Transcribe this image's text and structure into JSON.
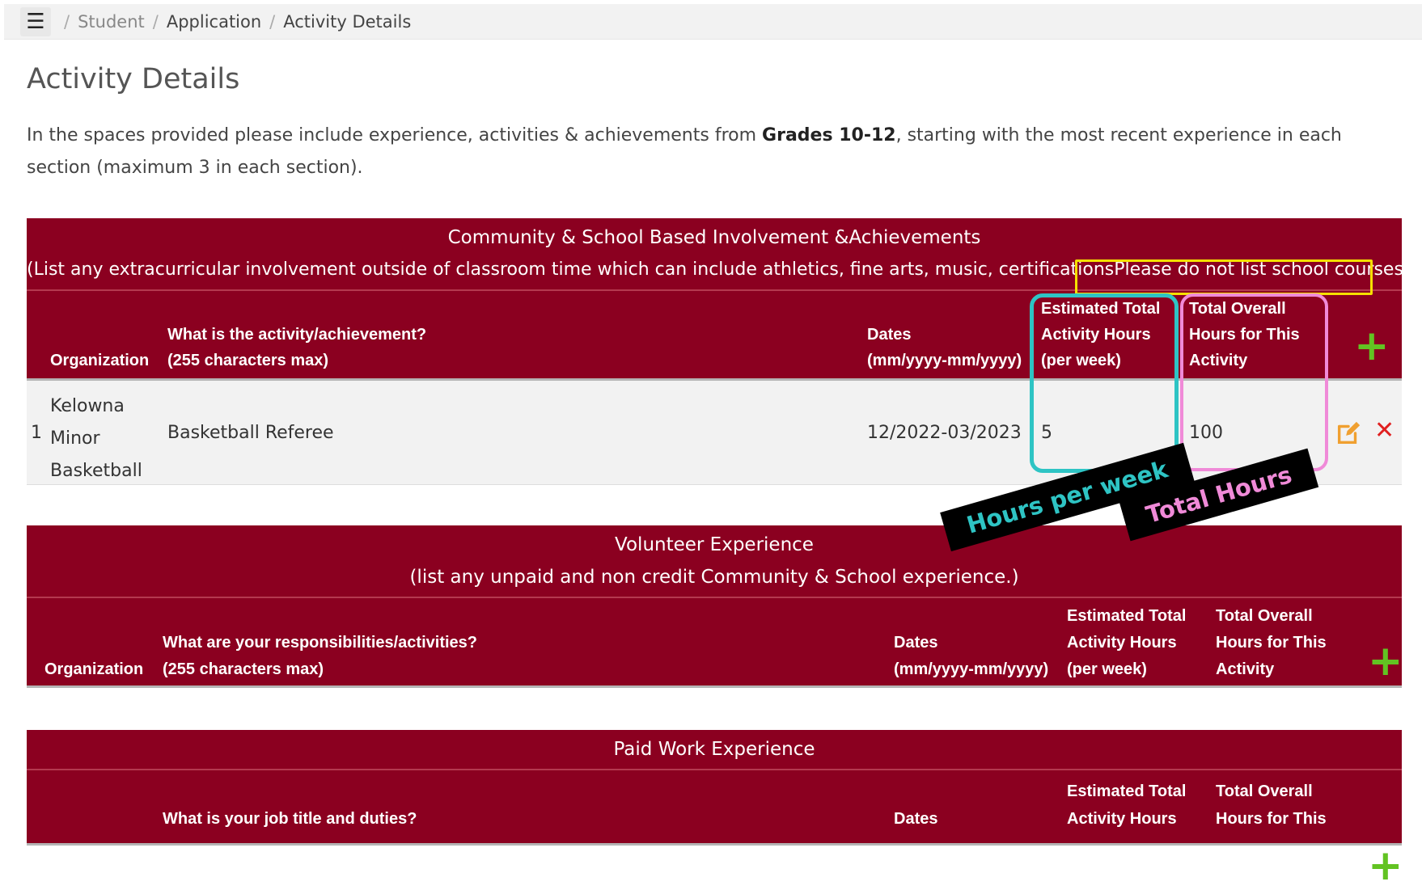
{
  "breadcrumb": {
    "sep": "/",
    "items": [
      "Student",
      "Application",
      "Activity Details"
    ]
  },
  "page": {
    "title": "Activity Details",
    "intro_part1": "In the spaces provided please include experience, activities & achievements from ",
    "intro_bold": "Grades 10-12",
    "intro_part2": ", starting with the most recent experience in each section (maximum 3 in each section)."
  },
  "community": {
    "title": "Community & School Based Involvement &Achievements",
    "subtitle_main": "(List any extracurricular involvement outside of classroom time which can include athletics, fine arts, music, certifications",
    "subtitle_note": "Please do not list school courses)",
    "columns": {
      "organization": "Organization",
      "activity_1": "What is the activity/achievement?",
      "activity_2": "(255 characters max)",
      "dates_1": "Dates",
      "dates_2": "(mm/yyyy-mm/yyyy)",
      "est_1": "Estimated Total",
      "est_2": "Activity Hours",
      "est_3": "(per week)",
      "total_1": "Total Overall",
      "total_2": "Hours for This",
      "total_3": "Activity"
    },
    "rows": [
      {
        "num": "1",
        "org_1": "Kelowna",
        "org_2": "Minor",
        "org_3": "Basketball",
        "activity": "Basketball Referee",
        "dates": "12/2022-03/2023",
        "hours_week": "5",
        "total_hours": "100"
      }
    ]
  },
  "volunteer": {
    "title": "Volunteer Experience",
    "subtitle": "(list any unpaid and non credit Community & School experience.)",
    "columns": {
      "organization": "Organization",
      "activity_1": "What are your responsibilities/activities?",
      "activity_2": "(255 characters max)",
      "dates_1": "Dates",
      "dates_2": "(mm/yyyy-mm/yyyy)",
      "est_1": "Estimated Total",
      "est_2": "Activity Hours",
      "est_3": "(per week)",
      "total_1": "Total Overall",
      "total_2": "Hours for This",
      "total_3": "Activity"
    }
  },
  "paid": {
    "title": "Paid Work Experience",
    "columns": {
      "activity_1": "What is your job title and duties?",
      "dates_1": "Dates",
      "est_1": "Estimated Total",
      "est_2": "Activity Hours",
      "total_1": "Total Overall",
      "total_2": "Hours for This"
    }
  },
  "annotations": {
    "hours_per_week": "Hours per week",
    "total_hours": "Total Hours"
  },
  "colors": {
    "header_bg": "#8b0020",
    "add_plus": "#62c322",
    "edit_icon": "#f0a030",
    "delete_icon": "#e02020",
    "highlight_yellow": "#f5e000",
    "highlight_teal": "#2ec4c4",
    "highlight_pink": "#f08ad8"
  }
}
